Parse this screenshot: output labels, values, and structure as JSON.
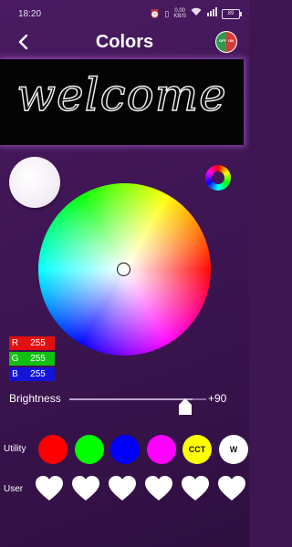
{
  "status_bar": {
    "time": "18:20",
    "data_speed_value": "0.00",
    "data_speed_unit": "KB/S",
    "battery": "89"
  },
  "header": {
    "title": "Colors",
    "power_off_label": "OFF",
    "power_on_label": "ON"
  },
  "preview": {
    "text": "welcome"
  },
  "rgb": {
    "r_label": "R",
    "r_value": "255",
    "g_label": "G",
    "g_value": "255",
    "b_label": "B",
    "b_value": "255"
  },
  "brightness": {
    "label": "Brightness",
    "value_text": "+90",
    "level_fraction": 0.9
  },
  "utility": {
    "label": "Utility",
    "swatches": [
      {
        "color": "#ff0000",
        "text": ""
      },
      {
        "color": "#00ff00",
        "text": ""
      },
      {
        "color": "#0000ff",
        "text": ""
      },
      {
        "color": "#ff00ff",
        "text": ""
      },
      {
        "color": "#ffff00",
        "text": "CCT"
      },
      {
        "color": "#ffffff",
        "text": "W"
      }
    ]
  },
  "user": {
    "label": "User",
    "slot_count": 6,
    "heart_color": "#ffffff"
  },
  "colors": {
    "accent": "#3d1652",
    "selected": "#ffffff"
  }
}
